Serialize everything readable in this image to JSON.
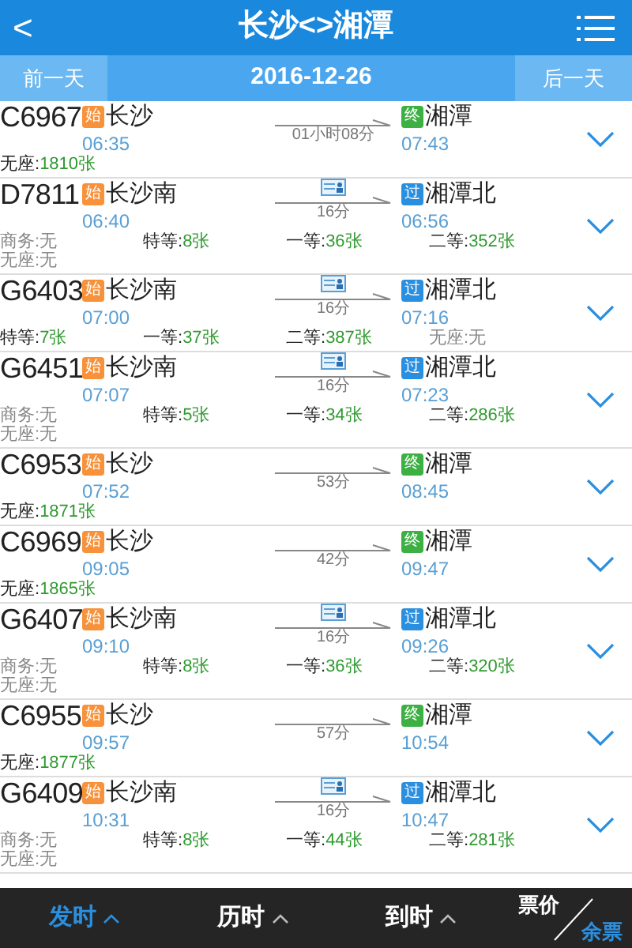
{
  "header": {
    "back": "<",
    "title": "长沙<>湘潭"
  },
  "date_bar": {
    "prev": "前一天",
    "date": "2016-12-26",
    "next": "后一天"
  },
  "trains": [
    {
      "code": "C6967",
      "from": {
        "kind": "start",
        "badge": "始",
        "name": "长沙",
        "time": "06:35"
      },
      "id_card": false,
      "duration": "01小时08分",
      "to": {
        "kind": "end",
        "badge": "终",
        "name": "湘潭",
        "time": "07:43"
      },
      "seats": [
        {
          "label": "无座:",
          "value": "1810张",
          "available": true
        }
      ]
    },
    {
      "code": "D7811",
      "from": {
        "kind": "start",
        "badge": "始",
        "name": "长沙南",
        "time": "06:40"
      },
      "id_card": true,
      "duration": "16分",
      "to": {
        "kind": "pass",
        "badge": "过",
        "name": "湘潭北",
        "time": "06:56"
      },
      "seats": [
        {
          "label": "商务:",
          "value": "无",
          "available": false
        },
        {
          "label": "特等:",
          "value": "8张",
          "available": true
        },
        {
          "label": "一等:",
          "value": "36张",
          "available": true
        },
        {
          "label": "二等:",
          "value": "352张",
          "available": true
        },
        {
          "label": "无座:",
          "value": "无",
          "available": false
        }
      ]
    },
    {
      "code": "G6403",
      "from": {
        "kind": "start",
        "badge": "始",
        "name": "长沙南",
        "time": "07:00"
      },
      "id_card": true,
      "duration": "16分",
      "to": {
        "kind": "pass",
        "badge": "过",
        "name": "湘潭北",
        "time": "07:16"
      },
      "seats": [
        {
          "label": "特等:",
          "value": "7张",
          "available": true
        },
        {
          "label": "一等:",
          "value": "37张",
          "available": true
        },
        {
          "label": "二等:",
          "value": "387张",
          "available": true
        },
        {
          "label": "无座:",
          "value": "无",
          "available": false
        }
      ]
    },
    {
      "code": "G6451",
      "from": {
        "kind": "start",
        "badge": "始",
        "name": "长沙南",
        "time": "07:07"
      },
      "id_card": true,
      "duration": "16分",
      "to": {
        "kind": "pass",
        "badge": "过",
        "name": "湘潭北",
        "time": "07:23"
      },
      "seats": [
        {
          "label": "商务:",
          "value": "无",
          "available": false
        },
        {
          "label": "特等:",
          "value": "5张",
          "available": true
        },
        {
          "label": "一等:",
          "value": "34张",
          "available": true
        },
        {
          "label": "二等:",
          "value": "286张",
          "available": true
        },
        {
          "label": "无座:",
          "value": "无",
          "available": false
        }
      ]
    },
    {
      "code": "C6953",
      "from": {
        "kind": "start",
        "badge": "始",
        "name": "长沙",
        "time": "07:52"
      },
      "id_card": false,
      "duration": "53分",
      "to": {
        "kind": "end",
        "badge": "终",
        "name": "湘潭",
        "time": "08:45"
      },
      "seats": [
        {
          "label": "无座:",
          "value": "1871张",
          "available": true
        }
      ]
    },
    {
      "code": "C6969",
      "from": {
        "kind": "start",
        "badge": "始",
        "name": "长沙",
        "time": "09:05"
      },
      "id_card": false,
      "duration": "42分",
      "to": {
        "kind": "end",
        "badge": "终",
        "name": "湘潭",
        "time": "09:47"
      },
      "seats": [
        {
          "label": "无座:",
          "value": "1865张",
          "available": true
        }
      ]
    },
    {
      "code": "G6407",
      "from": {
        "kind": "start",
        "badge": "始",
        "name": "长沙南",
        "time": "09:10"
      },
      "id_card": true,
      "duration": "16分",
      "to": {
        "kind": "pass",
        "badge": "过",
        "name": "湘潭北",
        "time": "09:26"
      },
      "seats": [
        {
          "label": "商务:",
          "value": "无",
          "available": false
        },
        {
          "label": "特等:",
          "value": "8张",
          "available": true
        },
        {
          "label": "一等:",
          "value": "36张",
          "available": true
        },
        {
          "label": "二等:",
          "value": "320张",
          "available": true
        },
        {
          "label": "无座:",
          "value": "无",
          "available": false
        }
      ]
    },
    {
      "code": "C6955",
      "from": {
        "kind": "start",
        "badge": "始",
        "name": "长沙",
        "time": "09:57"
      },
      "id_card": false,
      "duration": "57分",
      "to": {
        "kind": "end",
        "badge": "终",
        "name": "湘潭",
        "time": "10:54"
      },
      "seats": [
        {
          "label": "无座:",
          "value": "1877张",
          "available": true
        }
      ]
    },
    {
      "code": "G6409",
      "from": {
        "kind": "start",
        "badge": "始",
        "name": "长沙南",
        "time": "10:31"
      },
      "id_card": true,
      "duration": "16分",
      "to": {
        "kind": "pass",
        "badge": "过",
        "name": "湘潭北",
        "time": "10:47"
      },
      "seats": [
        {
          "label": "商务:",
          "value": "无",
          "available": false
        },
        {
          "label": "特等:",
          "value": "8张",
          "available": true
        },
        {
          "label": "一等:",
          "value": "44张",
          "available": true
        },
        {
          "label": "二等:",
          "value": "281张",
          "available": true
        },
        {
          "label": "无座:",
          "value": "无",
          "available": false
        }
      ]
    }
  ],
  "sort_bar": [
    {
      "kind": "sort",
      "label": "发时",
      "selected": true
    },
    {
      "kind": "sort",
      "label": "历时",
      "selected": false
    },
    {
      "kind": "sort",
      "label": "到时",
      "selected": false
    },
    {
      "kind": "split",
      "top": "票价",
      "top_selected": false,
      "bottom": "余票",
      "bottom_selected": true
    }
  ]
}
